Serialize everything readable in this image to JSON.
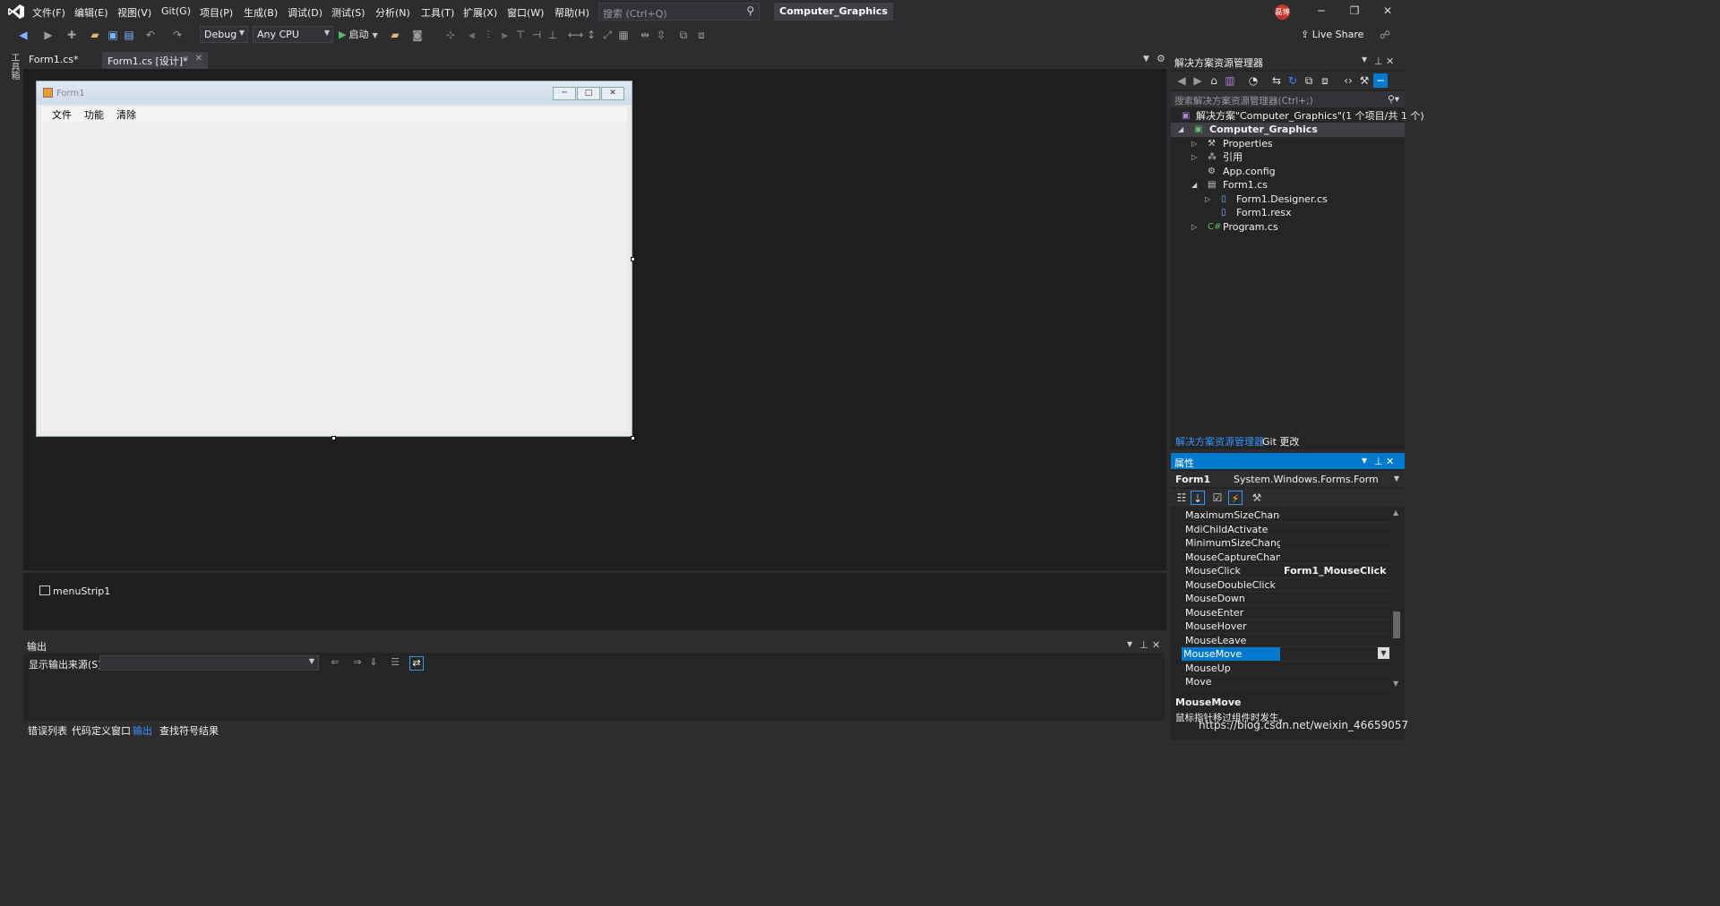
{
  "menubar": {
    "items": [
      "文件(F)",
      "编辑(E)",
      "视图(V)",
      "Git(G)",
      "项目(P)",
      "生成(B)",
      "调试(D)",
      "测试(S)",
      "分析(N)",
      "工具(T)",
      "扩展(X)",
      "窗口(W)",
      "帮助(H)"
    ],
    "search_placeholder": "搜索 (Ctrl+Q)",
    "solution_title": "Computer_Graphics",
    "avatar_text": "磊博"
  },
  "toolbar": {
    "config": "Debug",
    "platform": "Any CPU",
    "start_label": "启动",
    "live_share": "Live Share"
  },
  "left_strip_label": "工具箱",
  "doc_tabs": [
    "Form1.cs*",
    "Form1.cs [设计]*"
  ],
  "designer": {
    "form_title": "Form1",
    "form_menu": [
      "文件",
      "功能",
      "清除"
    ],
    "tray_item": "menuStrip1"
  },
  "output": {
    "title": "输出",
    "source_label": "显示输出来源(S):"
  },
  "bottom_tabs": [
    "错误列表",
    "代码定义窗口",
    "输出",
    "查找符号结果"
  ],
  "solution_explorer": {
    "title": "解决方案资源管理器",
    "search_placeholder": "搜索解决方案资源管理器(Ctrl+;)",
    "tree": [
      {
        "label": "解决方案\"Computer_Graphics\"(1 个项目/共 1 个)"
      },
      {
        "label": "Computer_Graphics"
      },
      {
        "label": "Properties"
      },
      {
        "label": "引用"
      },
      {
        "label": "App.config"
      },
      {
        "label": "Form1.cs"
      },
      {
        "label": "Form1.Designer.cs"
      },
      {
        "label": "Form1.resx"
      },
      {
        "label": "Program.cs"
      }
    ],
    "tabs": [
      "解决方案资源管理器",
      "Git 更改"
    ]
  },
  "properties": {
    "title": "属性",
    "object_name": "Form1",
    "object_type": "System.Windows.Forms.Form",
    "rows": [
      {
        "k": "MaximumSizeChanged",
        "v": ""
      },
      {
        "k": "MdiChildActivate",
        "v": ""
      },
      {
        "k": "MinimumSizeChanged",
        "v": ""
      },
      {
        "k": "MouseCaptureChanged",
        "v": ""
      },
      {
        "k": "MouseClick",
        "v": "Form1_MouseClick"
      },
      {
        "k": "MouseDoubleClick",
        "v": ""
      },
      {
        "k": "MouseDown",
        "v": ""
      },
      {
        "k": "MouseEnter",
        "v": ""
      },
      {
        "k": "MouseHover",
        "v": ""
      },
      {
        "k": "MouseLeave",
        "v": ""
      },
      {
        "k": "MouseMove",
        "v": ""
      },
      {
        "k": "MouseUp",
        "v": ""
      },
      {
        "k": "Move",
        "v": ""
      }
    ],
    "desc_name": "MouseMove",
    "desc_text": "鼠标指针移过组件时发生。"
  },
  "watermark": "https://blog.csdn.net/weixin_46659057",
  "colors": {
    "accent": "#007acc",
    "background": "#2d2d30",
    "editor": "#1e1e1e"
  }
}
